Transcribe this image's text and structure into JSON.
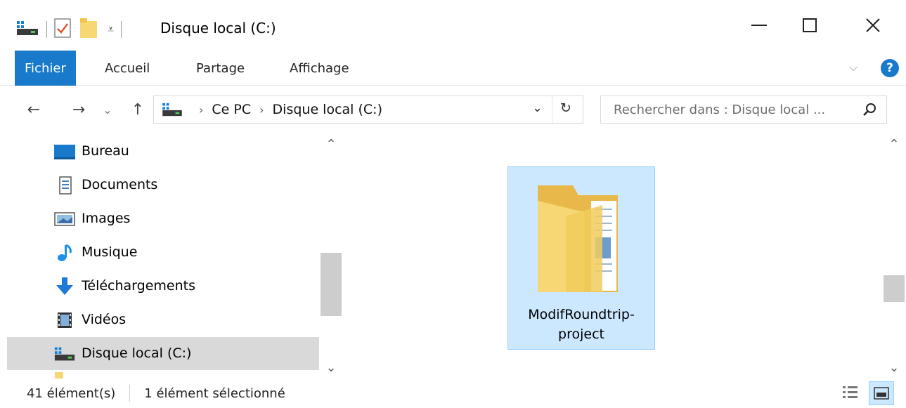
{
  "window": {
    "title": "Disque local (C:)",
    "minimize": "—",
    "maximize": "☐",
    "close": "✕"
  },
  "ribbon": {
    "tabs": [
      {
        "label": "Fichier",
        "active": true
      },
      {
        "label": "Accueil"
      },
      {
        "label": "Partage"
      },
      {
        "label": "Affichage"
      }
    ],
    "help": "?"
  },
  "nav": {
    "back": "←",
    "forward": "→",
    "recent": "⌄",
    "up": "↑",
    "breadcrumb": [
      "Ce PC",
      "Disque local (C:)"
    ],
    "breadcrumb_sep": "›",
    "dropdown": "⌄",
    "refresh": "↻",
    "search_placeholder": "Rechercher dans : Disque local ..."
  },
  "sidebar": {
    "items": [
      {
        "label": "Bureau",
        "icon": "desktop-icon"
      },
      {
        "label": "Documents",
        "icon": "documents-icon"
      },
      {
        "label": "Images",
        "icon": "pictures-icon"
      },
      {
        "label": "Musique",
        "icon": "music-icon"
      },
      {
        "label": "Téléchargements",
        "icon": "downloads-icon"
      },
      {
        "label": "Vidéos",
        "icon": "videos-icon"
      },
      {
        "label": "Disque local (C:)",
        "icon": "drive-icon",
        "selected": true
      }
    ]
  },
  "content": {
    "items": [
      {
        "name": "ModifRoundtrip-\nproject",
        "type": "folder",
        "selected": true
      }
    ]
  },
  "status": {
    "count": "41 élément(s)",
    "selected": "1 élément sélectionné"
  },
  "colors": {
    "accent": "#1979ca",
    "selection": "#cce8ff",
    "selection_border": "#99d1ff",
    "folder": "#f7d674",
    "nav_selected": "#d9d9d9"
  }
}
